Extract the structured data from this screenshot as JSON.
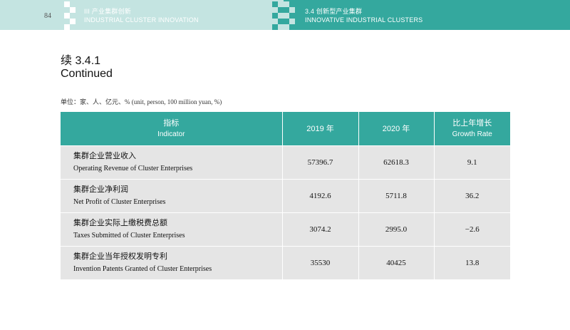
{
  "header": {
    "page_number": "84",
    "left_cn": "III  产业集群创新",
    "left_en": "INDUSTRIAL CLUSTER INNOVATION",
    "right_cn": "3.4  创新型产业集群",
    "right_en": "INNOVATIVE INDUSTRIAL CLUSTERS"
  },
  "title": {
    "cn": "续 3.4.1",
    "en": "Continued"
  },
  "unit": "单位：家、人、亿元、%  (unit, person, 100 million yuan, %)",
  "table": {
    "columns": [
      {
        "cn": "指标",
        "en": "Indicator"
      },
      {
        "cn": "2019 年",
        "en": ""
      },
      {
        "cn": "2020 年",
        "en": ""
      },
      {
        "cn": "比上年增长",
        "en": "Growth Rate"
      }
    ],
    "rows": [
      {
        "cn": "集群企业营业收入",
        "en": "Operating Revenue of Cluster Enterprises",
        "v2019": "57396.7",
        "v2020": "62618.3",
        "growth": "9.1"
      },
      {
        "cn": "集群企业净利润",
        "en": "Net Profit of Cluster Enterprises",
        "v2019": "4192.6",
        "v2020": "5711.8",
        "growth": "36.2"
      },
      {
        "cn": "集群企业实际上缴税费总额",
        "en": "Taxes Submitted of Cluster Enterprises",
        "v2019": "3074.2",
        "v2020": "2995.0",
        "growth": "−2.6"
      },
      {
        "cn": "集群企业当年授权发明专利",
        "en": "Invention Patents Granted of Cluster Enterprises",
        "v2019": "35530",
        "v2020": "40425",
        "growth": "13.8"
      }
    ]
  }
}
